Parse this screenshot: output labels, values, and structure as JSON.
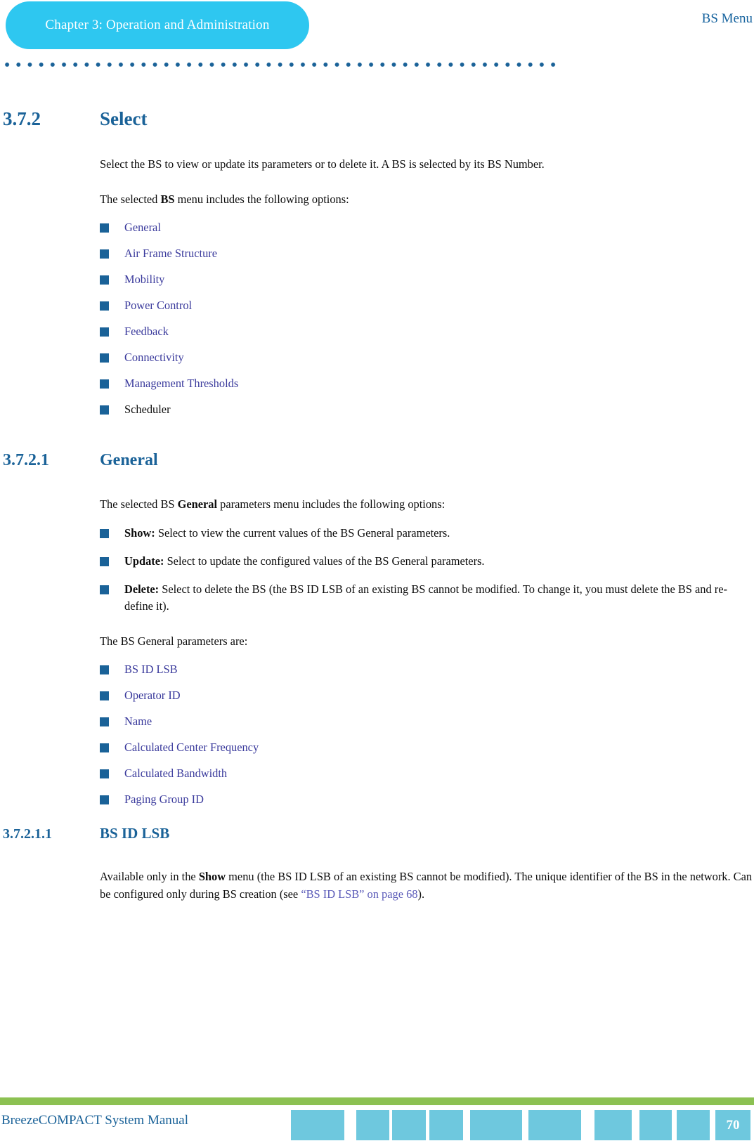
{
  "header": {
    "chapter_label": "Chapter 3: Operation and Administration",
    "running_head": "BS Menu"
  },
  "sections": {
    "select": {
      "number": "3.7.2",
      "title": "Select",
      "intro": "Select the BS to view or update its parameters or to delete it. A BS is selected by its BS Number.",
      "menu_lead_pre": "The selected ",
      "menu_lead_bold": "BS",
      "menu_lead_post": " menu includes the following options:",
      "options": [
        "General",
        "Air Frame Structure",
        "Mobility",
        "Power Control",
        "Feedback",
        "Connectivity",
        "Management Thresholds",
        "Scheduler"
      ]
    },
    "general": {
      "number": "3.7.2.1",
      "title": "General",
      "lead_pre": "The selected BS ",
      "lead_bold": "General",
      "lead_post": " parameters menu includes the following options:",
      "actions": [
        {
          "label": "Show:",
          "text": " Select to view the current values of the BS General parameters."
        },
        {
          "label": "Update:",
          "text": " Select to update the configured values of the BS General parameters."
        },
        {
          "label": "Delete:",
          "text": " Select to delete the BS (the BS ID LSB of an existing BS cannot be modified. To change it, you must delete the BS and re-define it)."
        }
      ],
      "params_lead": "The BS General parameters are:",
      "params": [
        "BS ID LSB",
        "Operator ID",
        "Name",
        "Calculated Center Frequency",
        "Calculated Bandwidth",
        "Paging Group ID"
      ]
    },
    "bs_id_lsb": {
      "number": "3.7.2.1.1",
      "title": "BS ID LSB",
      "body_pre": "Available only in the ",
      "body_bold": "Show",
      "body_mid": " menu (the BS ID LSB of an existing BS cannot be modified). The unique identifier of the BS in the network. Can be configured only during BS creation (see ",
      "body_link": "“BS ID LSB” on page 68",
      "body_post": ")."
    }
  },
  "footer": {
    "manual_title": "BreezeCOMPACT System Manual",
    "page_number": "70"
  },
  "colors": {
    "accent_cyan": "#2ec7f0",
    "heading_blue": "#1a6298",
    "link_blue": "#3a3a9c",
    "footer_green": "#8cc152",
    "footer_block": "#6ec8de"
  }
}
